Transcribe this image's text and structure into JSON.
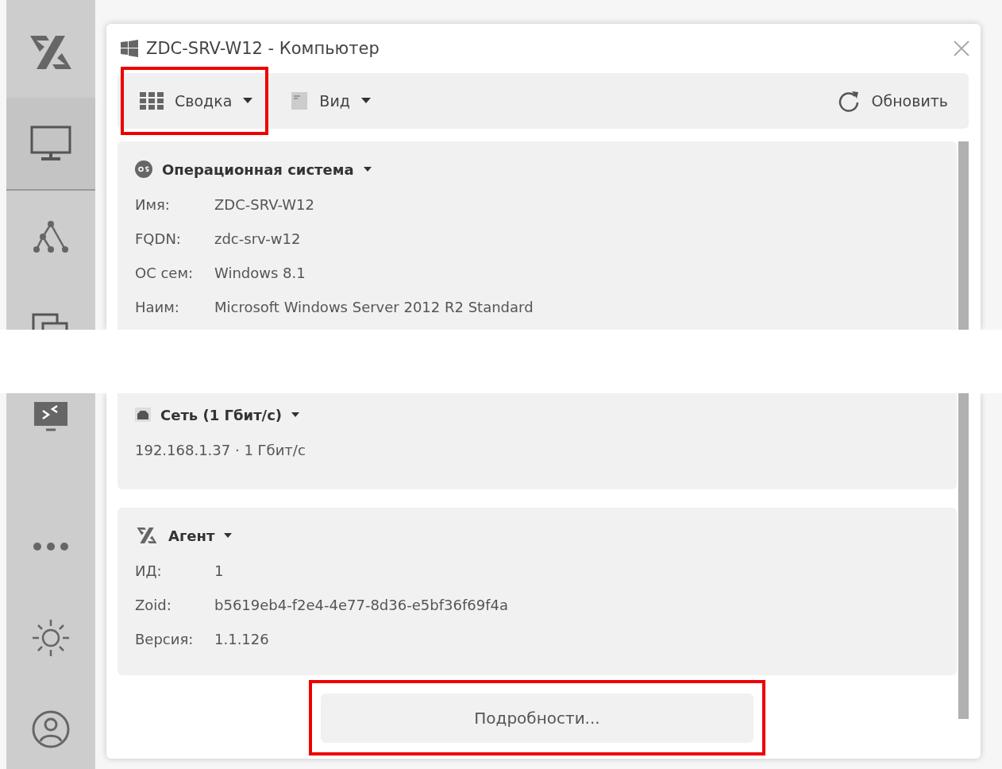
{
  "sidebar": {
    "items_before_tear": [
      {
        "kind": "logo",
        "selected": false
      },
      {
        "kind": "computer",
        "selected": true
      },
      {
        "kind": "hierarchy",
        "selected": false
      },
      {
        "kind": "windows",
        "selected": false
      }
    ],
    "items_after_tear": [
      {
        "kind": "remote",
        "selected": false
      },
      {
        "kind": "more",
        "selected": false
      },
      {
        "kind": "theme",
        "selected": false
      },
      {
        "kind": "account",
        "selected": false
      }
    ]
  },
  "window": {
    "title": "ZDC-SRV-W12 - Компьютер"
  },
  "toolbar": {
    "items": [
      {
        "kind": "summary",
        "label": "Сводка",
        "highlighted": true
      },
      {
        "kind": "view",
        "label": "Вид",
        "highlighted": false
      }
    ],
    "refresh": {
      "label": "Обновить"
    }
  },
  "sections_before_tear": [
    {
      "kind": "os",
      "title": "Операционная система",
      "rows": [
        {
          "label": "Имя:",
          "value": "ZDC-SRV-W12"
        },
        {
          "label": "FQDN:",
          "value": "zdc-srv-w12"
        },
        {
          "label": "ОС сем:",
          "value": "Windows 8.1"
        },
        {
          "label": "Наим:",
          "value": "Microsoft Windows Server 2012 R2 Standard"
        }
      ]
    }
  ],
  "sections_after_tear": [
    {
      "kind": "network",
      "title": "Сеть (1 Гбит/с)",
      "lines": [
        "192.168.1.37 · 1 Гбит/с"
      ]
    },
    {
      "kind": "agent",
      "title": "Агент",
      "rows": [
        {
          "label": "ИД:",
          "value": "1"
        },
        {
          "label": "Zoid:",
          "value": "b5619eb4-f2e4-4e77-8d36-e5bf36f69f4a"
        },
        {
          "label": "Версия:",
          "value": "1.1.126"
        }
      ]
    }
  ],
  "details_button": {
    "label": "Подробности...",
    "highlighted": true
  }
}
